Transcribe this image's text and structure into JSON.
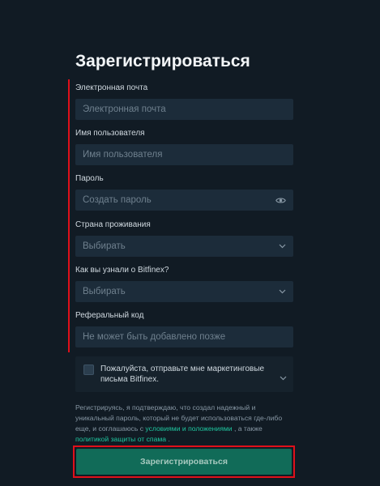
{
  "form": {
    "title": "Зарегистрироваться",
    "email": {
      "label": "Электронная почта",
      "placeholder": "Электронная почта"
    },
    "username": {
      "label": "Имя пользователя",
      "placeholder": "Имя пользователя"
    },
    "password": {
      "label": "Пароль",
      "placeholder": "Создать пароль"
    },
    "country": {
      "label": "Страна проживания",
      "value": "Выбирать"
    },
    "source": {
      "label": "Как вы узнали о Bitfinex?",
      "value": "Выбирать"
    },
    "referral": {
      "label": "Реферальный код",
      "placeholder": "Не может быть добавлено позже"
    },
    "marketing": {
      "text": "Пожалуйста, отправьте мне маркетинговые письма Bitfinex."
    },
    "terms": {
      "part1": "Регистрируясь, я подтверждаю, что создал надежный и уникальный пароль, который не будет использоваться где-либо еще, и соглашаюсь с",
      "link1": "условиями и положениями",
      "part2": ", а также",
      "link2": "политикой защиты от спама",
      "part3": "."
    },
    "submit_label": "Зарегистрироваться"
  },
  "colors": {
    "background": "#111b24",
    "input": "#1c2c3a",
    "accent": "#1fc7a0",
    "button": "#116b58",
    "annotation": "#e0101a"
  }
}
